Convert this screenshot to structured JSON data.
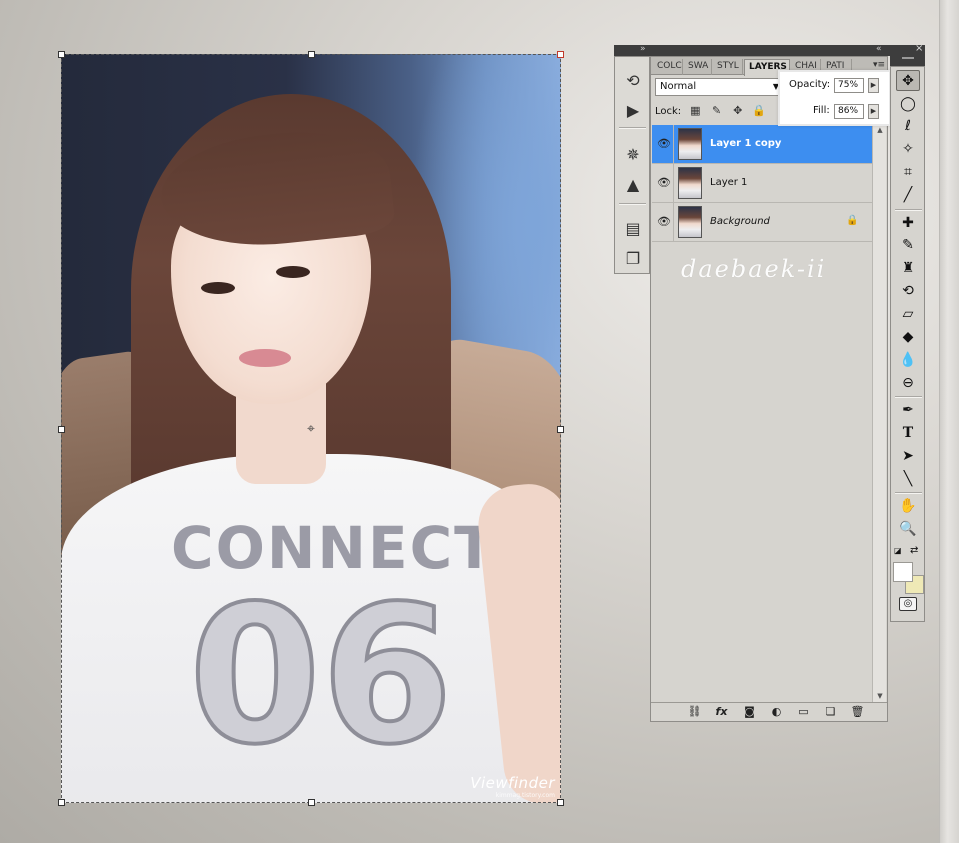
{
  "dock": {
    "icons": [
      "history-icon",
      "actions-icon",
      "navigator-icon",
      "histogram-icon",
      "info-icon",
      "layer-comps-icon"
    ]
  },
  "layers_panel": {
    "tabs": [
      "COLC",
      "SWA",
      "STYL",
      "LAYERS",
      "CHAI",
      "PATI"
    ],
    "active_tab": "LAYERS",
    "blend_mode": "Normal",
    "opacity_label": "Opacity:",
    "opacity_value": "75%",
    "lock_label": "Lock:",
    "fill_label": "Fill:",
    "fill_value": "86%",
    "layers": [
      {
        "name": "Layer 1 copy",
        "selected": true,
        "visible": true
      },
      {
        "name": "Layer 1",
        "selected": false,
        "visible": true
      },
      {
        "name": "Background",
        "selected": false,
        "visible": true,
        "locked": true
      }
    ],
    "watermark": "daebaek-ii",
    "bottom_icons": [
      "link-layers-icon",
      "fx-icon",
      "add-mask-icon",
      "adjustment-layer-icon",
      "new-group-icon",
      "new-layer-icon",
      "delete-layer-icon"
    ]
  },
  "canvas": {
    "shirt_text_top": "CONNECT",
    "shirt_text_bottom": "06",
    "watermark_main": "Viewfinder",
    "watermark_sub": "kimmag.tistory.com"
  },
  "colors": {
    "selection_blue": "#3d8ef0",
    "foreground_color": "#ffffff",
    "background_color": "#efe9b6"
  }
}
